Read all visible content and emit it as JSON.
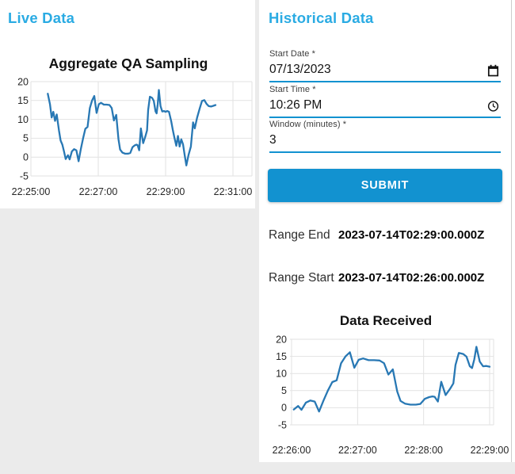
{
  "colors": {
    "page_background": "#ebebeb",
    "card_background": "#ffffff",
    "heading_blue": "#2aabe3",
    "accent_blue": "#1292d0",
    "line_blue": "#2878b4",
    "grid": "#e2e2e2",
    "tick": "#262626",
    "chart_title": "#111111"
  },
  "live_panel": {
    "title": "Live Data"
  },
  "historical_panel": {
    "title": "Historical Data",
    "form": {
      "start_date": {
        "label": "Start Date *",
        "value": "07/13/2023",
        "icon": "calendar-icon"
      },
      "start_time": {
        "label": "Start Time *",
        "value": "10:26 PM",
        "icon": "clock-icon"
      },
      "window": {
        "label": "Window (minutes) *",
        "value": "3"
      },
      "submit_label": "SUBMIT"
    },
    "range_end": {
      "label": "Range End",
      "value": "2023-07-14T02:29:00.000Z"
    },
    "range_start": {
      "label": "Range Start",
      "value": "2023-07-14T02:26:00.000Z"
    }
  },
  "chart_data": [
    {
      "id": "aggregate-qa-sampling",
      "type": "line",
      "title": "Aggregate QA Sampling",
      "x_tick_labels": [
        "22:25:00",
        "22:27:00",
        "22:29:00",
        "22:31:00"
      ],
      "x_tick_seconds": [
        0,
        120,
        240,
        360
      ],
      "y_ticks": [
        -5,
        0,
        5,
        10,
        15,
        20
      ],
      "ylim": [
        -5,
        20
      ],
      "grid": true,
      "legend": "none",
      "line_color": "#2878b4",
      "series": [
        {
          "name": "aggregate-qa",
          "points": [
            [
              30,
              16.8
            ],
            [
              34,
              14.0
            ],
            [
              37,
              10.5
            ],
            [
              40,
              12.0
            ],
            [
              43,
              9.6
            ],
            [
              46,
              11.3
            ],
            [
              50,
              7.1
            ],
            [
              53,
              4.4
            ],
            [
              56,
              3.3
            ],
            [
              59,
              1.5
            ],
            [
              62,
              -0.5
            ],
            [
              66,
              0.5
            ],
            [
              69,
              -0.6
            ],
            [
              73,
              1.5
            ],
            [
              77,
              2.1
            ],
            [
              81,
              1.8
            ],
            [
              85,
              -1.1
            ],
            [
              89,
              2.1
            ],
            [
              93,
              5.0
            ],
            [
              97,
              7.5
            ],
            [
              101,
              8.0
            ],
            [
              105,
              13.0
            ],
            [
              109,
              15.0
            ],
            [
              113,
              16.2
            ],
            [
              117,
              11.7
            ],
            [
              121,
              14.0
            ],
            [
              125,
              14.4
            ],
            [
              130,
              13.9
            ],
            [
              135,
              13.9
            ],
            [
              140,
              13.8
            ],
            [
              144,
              13.0
            ],
            [
              148,
              9.7
            ],
            [
              152,
              11.2
            ],
            [
              156,
              4.8
            ],
            [
              159,
              2.0
            ],
            [
              163,
              1.2
            ],
            [
              168,
              0.9
            ],
            [
              173,
              0.9
            ],
            [
              177,
              1.1
            ],
            [
              181,
              2.6
            ],
            [
              185,
              3.1
            ],
            [
              188,
              3.3
            ],
            [
              190,
              3.2
            ],
            [
              193,
              1.8
            ],
            [
              196,
              7.6
            ],
            [
              200,
              3.7
            ],
            [
              204,
              5.5
            ],
            [
              207,
              7.1
            ],
            [
              209,
              12.5
            ],
            [
              212,
              16.0
            ],
            [
              216,
              15.7
            ],
            [
              219,
              14.9
            ],
            [
              222,
              12.1
            ],
            [
              224,
              11.6
            ],
            [
              226,
              14.1
            ],
            [
              228,
              17.8
            ],
            [
              231,
              13.5
            ],
            [
              234,
              12.1
            ],
            [
              237,
              12.2
            ],
            [
              240,
              12.0
            ],
            [
              243,
              12.2
            ],
            [
              246,
              12.0
            ],
            [
              250,
              9.5
            ],
            [
              253,
              7.1
            ],
            [
              256,
              5.0
            ],
            [
              259,
              3.0
            ],
            [
              262,
              5.6
            ],
            [
              265,
              2.8
            ],
            [
              268,
              4.7
            ],
            [
              271,
              3.4
            ],
            [
              274,
              0.5
            ],
            [
              277,
              -2.2
            ],
            [
              281,
              0.6
            ],
            [
              285,
              2.8
            ],
            [
              289,
              9.2
            ],
            [
              292,
              7.6
            ],
            [
              296,
              10.4
            ],
            [
              301,
              13.0
            ],
            [
              305,
              14.9
            ],
            [
              309,
              15.1
            ],
            [
              313,
              14.1
            ],
            [
              317,
              13.5
            ],
            [
              321,
              13.4
            ],
            [
              325,
              13.6
            ],
            [
              329,
              13.8
            ]
          ]
        }
      ]
    },
    {
      "id": "data-received",
      "type": "line",
      "title": "Data Received",
      "x_tick_labels": [
        "22:26:00",
        "22:27:00",
        "22:28:00",
        "22:29:00"
      ],
      "x_tick_seconds": [
        60,
        120,
        180,
        240
      ],
      "y_ticks": [
        -5,
        0,
        5,
        10,
        15,
        20
      ],
      "ylim": [
        -5,
        20
      ],
      "grid": true,
      "legend": "none",
      "line_color": "#2878b4",
      "series": [
        {
          "name": "data-received",
          "points": [
            [
              62,
              -0.5
            ],
            [
              66,
              0.5
            ],
            [
              69,
              -0.6
            ],
            [
              73,
              1.5
            ],
            [
              77,
              2.1
            ],
            [
              81,
              1.8
            ],
            [
              85,
              -1.1
            ],
            [
              89,
              2.1
            ],
            [
              93,
              5.0
            ],
            [
              97,
              7.5
            ],
            [
              101,
              8.0
            ],
            [
              105,
              13.0
            ],
            [
              109,
              15.0
            ],
            [
              113,
              16.2
            ],
            [
              117,
              11.7
            ],
            [
              121,
              14.0
            ],
            [
              125,
              14.4
            ],
            [
              130,
              13.9
            ],
            [
              135,
              13.9
            ],
            [
              140,
              13.8
            ],
            [
              144,
              13.0
            ],
            [
              148,
              9.7
            ],
            [
              152,
              11.2
            ],
            [
              156,
              4.8
            ],
            [
              159,
              2.0
            ],
            [
              163,
              1.2
            ],
            [
              168,
              0.9
            ],
            [
              173,
              0.9
            ],
            [
              177,
              1.1
            ],
            [
              181,
              2.6
            ],
            [
              185,
              3.1
            ],
            [
              188,
              3.3
            ],
            [
              190,
              3.2
            ],
            [
              193,
              1.8
            ],
            [
              196,
              7.6
            ],
            [
              200,
              3.7
            ],
            [
              204,
              5.5
            ],
            [
              207,
              7.1
            ],
            [
              209,
              12.5
            ],
            [
              212,
              16.0
            ],
            [
              216,
              15.7
            ],
            [
              219,
              14.9
            ],
            [
              222,
              12.1
            ],
            [
              224,
              11.6
            ],
            [
              226,
              14.1
            ],
            [
              228,
              17.8
            ],
            [
              231,
              13.5
            ],
            [
              234,
              12.1
            ],
            [
              237,
              12.2
            ],
            [
              240,
              12.0
            ]
          ]
        }
      ]
    }
  ]
}
